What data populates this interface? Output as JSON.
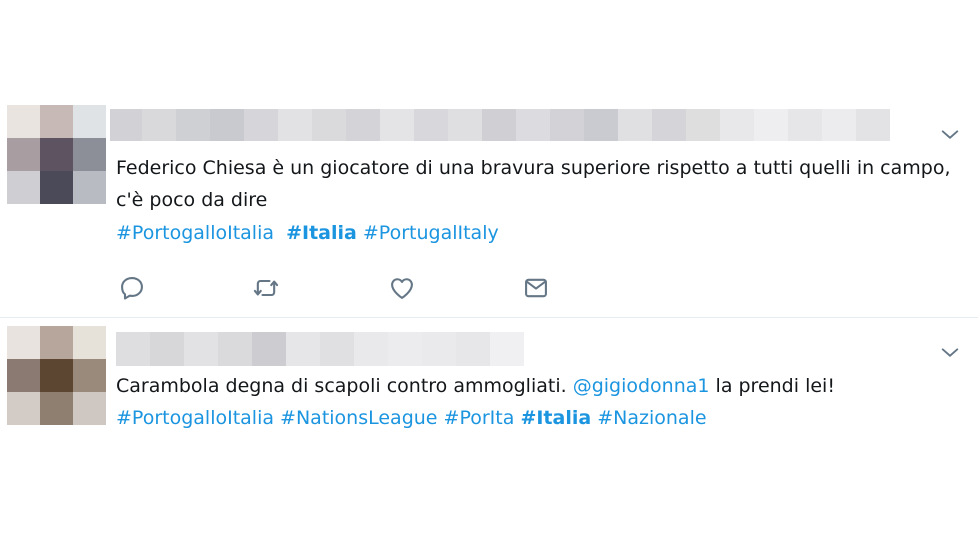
{
  "tweets": [
    {
      "text": "Federico Chiesa è un giocatore di una bravura superiore rispetto a tutti quelli in campo, c'è poco da dire",
      "hashtags": [
        {
          "label": "#PortogalloItalia",
          "bold": false
        },
        {
          "label": "#Italia",
          "bold": true
        },
        {
          "label": "#PortugalItaly",
          "bold": false
        }
      ],
      "actions": [
        "reply-icon",
        "retweet-icon",
        "like-icon",
        "direct-message-icon"
      ]
    },
    {
      "text_before": "Carambola degna di scapoli contro ammogliati. ",
      "mention": "@gigiodonna1",
      "text_after": " la prendi lei!",
      "hashtags": [
        {
          "label": "#PortogalloItalia",
          "bold": false
        },
        {
          "label": "#NationsLeague",
          "bold": false
        },
        {
          "label": "#PorIta",
          "bold": false
        },
        {
          "label": "#Italia",
          "bold": true
        },
        {
          "label": "#Nazionale",
          "bold": false
        }
      ]
    }
  ],
  "colors": {
    "link": "#1b95e0",
    "text": "#14171a",
    "icon": "#657786",
    "divider": "#e6ecf0"
  },
  "icons": [
    "chevron-down-icon",
    "reply-icon",
    "retweet-icon",
    "like-icon",
    "direct-message-icon"
  ]
}
